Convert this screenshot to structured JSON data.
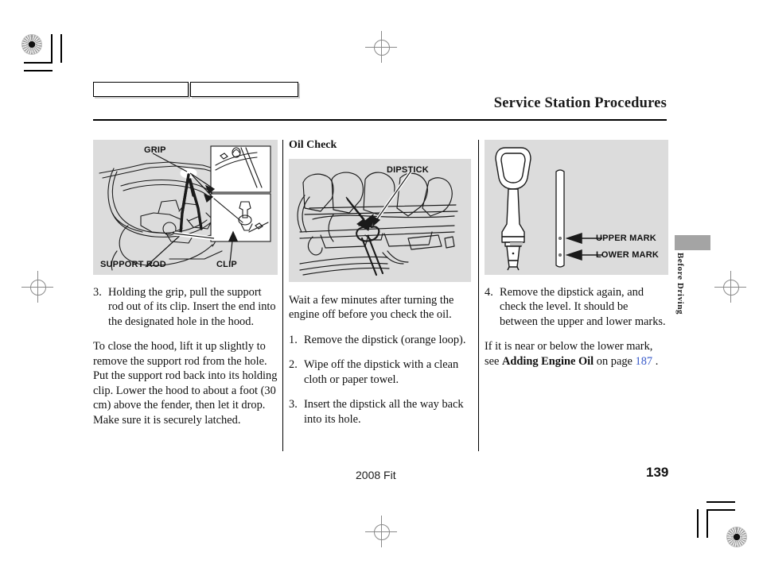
{
  "header": {
    "title": "Service Station Procedures"
  },
  "side_tab": {
    "label": "Before Driving"
  },
  "columns": {
    "left": {
      "figure": {
        "labels": {
          "grip": "GRIP",
          "support_rod": "SUPPORT ROD",
          "clip": "CLIP"
        }
      },
      "step": {
        "number": "3.",
        "text": "Holding the grip, pull the support rod out of its clip. Insert the end into the designated hole in the hood."
      },
      "paragraph": "To close the hood, lift it up slightly to remove the support rod from the hole. Put the support rod back into its holding clip. Lower the hood to about a foot (30 cm) above the fender, then let it drop. Make sure it is securely latched."
    },
    "middle": {
      "section_title": "Oil Check",
      "figure": {
        "labels": {
          "dipstick": "DIPSTICK"
        }
      },
      "intro": "Wait a few minutes after turning the engine off before you check the oil.",
      "steps": [
        {
          "number": "1.",
          "text": "Remove the dipstick (orange loop)."
        },
        {
          "number": "2.",
          "text": "Wipe off the dipstick with a clean cloth or paper towel."
        },
        {
          "number": "3.",
          "text": "Insert the dipstick all the way back into its hole."
        }
      ]
    },
    "right": {
      "figure": {
        "labels": {
          "upper_mark": "UPPER MARK",
          "lower_mark": "LOWER MARK"
        }
      },
      "step": {
        "number": "4.",
        "text": "Remove the dipstick again, and check the level. It should be between the upper and lower marks."
      },
      "crossref": {
        "lead": "If it is near or below the lower mark, see ",
        "bold": "Adding Engine Oil",
        "middle": " on page ",
        "page": "187",
        "tail": " ."
      }
    }
  },
  "footer": {
    "model_year": "2008  Fit",
    "page_number": "139"
  },
  "colors": {
    "illustration_background": "#dcdcdc",
    "link": "#3457c8",
    "thumb_tab": "#a4a4a4",
    "rule": "#000000"
  }
}
